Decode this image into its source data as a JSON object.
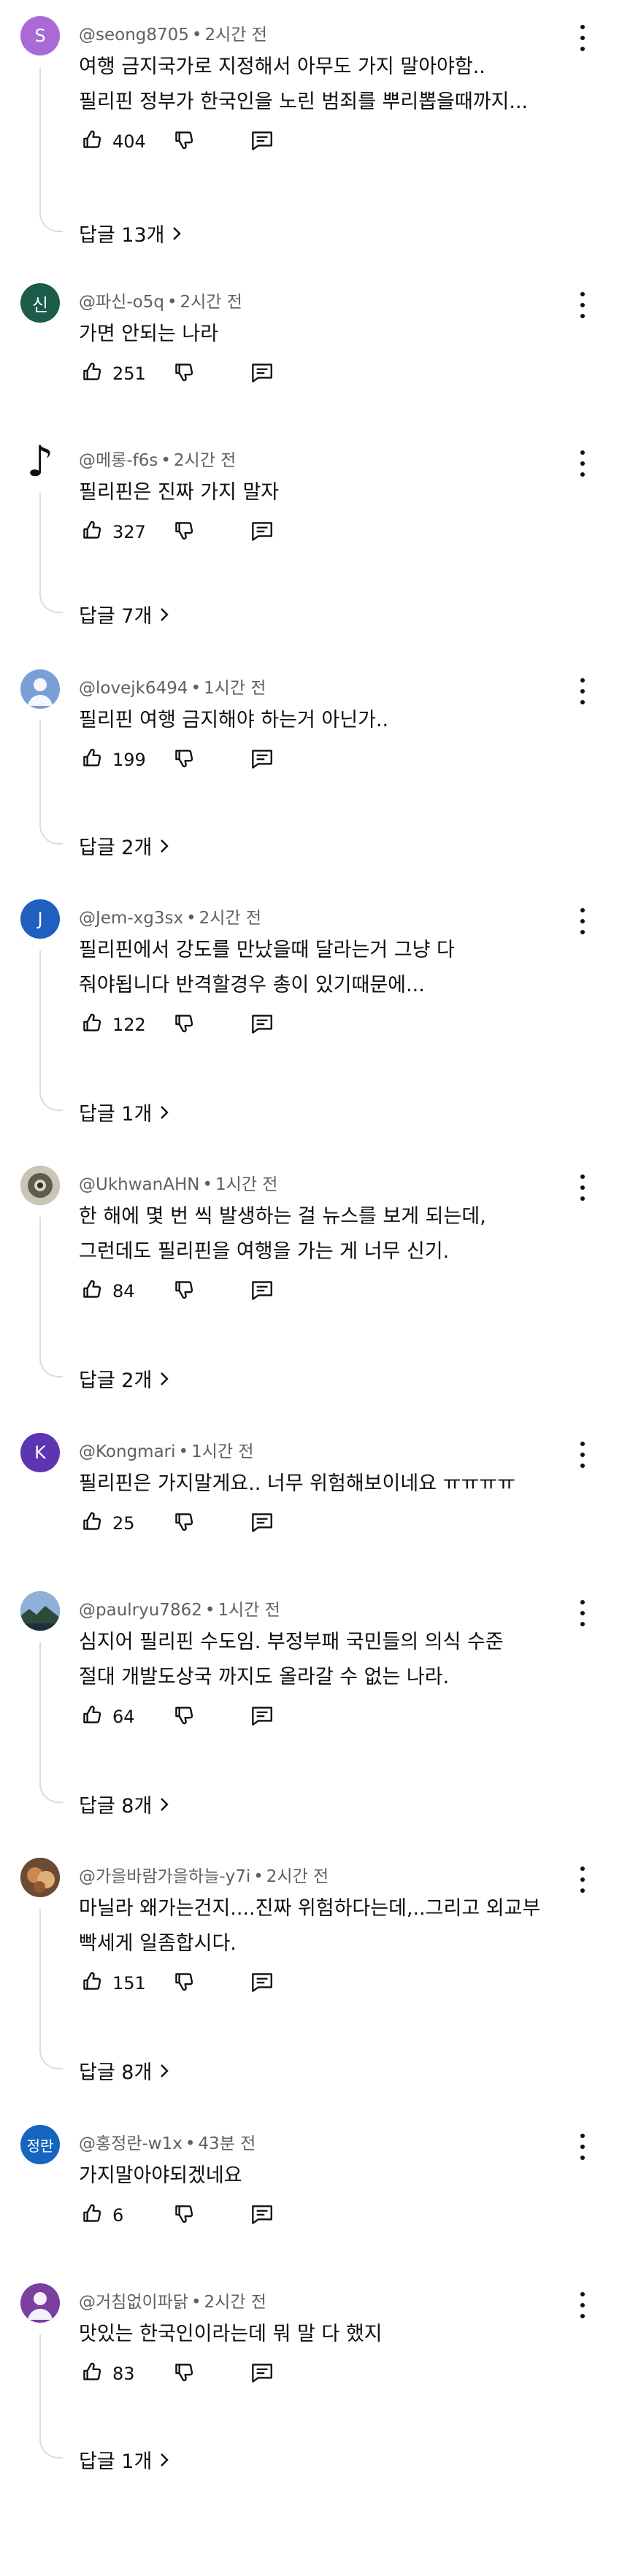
{
  "comments": [
    {
      "author": "@seong8705",
      "time": "2시간 전",
      "lines": [
        "여행 금지국가로 지정해서 아무도 가지 말아야함..",
        "필리핀 정부가 한국인을 노린 범죄를 뿌리뽑을때까지..."
      ],
      "likes": "404",
      "replies": "답글 13개",
      "avatar": {
        "letter": "S",
        "color": "#a86ad4"
      }
    },
    {
      "author": "@파신-o5q",
      "time": "2시간 전",
      "lines": [
        "가면 안되는 나라"
      ],
      "likes": "251",
      "replies": "",
      "avatar": {
        "letter": "신",
        "color": "#1b5c4b"
      }
    },
    {
      "author": "@메롱-f6s",
      "time": "2시간 전",
      "lines": [
        "필리핀은 진짜 가지 말자"
      ],
      "likes": "327",
      "replies": "답글 7개",
      "avatar": {
        "letter": "♪",
        "color": "#ffffff",
        "type": "note"
      }
    },
    {
      "author": "@lovejk6494",
      "time": "1시간 전",
      "lines": [
        "필리핀 여행 금지해야 하는거 아닌가.."
      ],
      "likes": "199",
      "replies": "답글 2개",
      "avatar": {
        "letter": "",
        "color": "#7a9ed6",
        "type": "person"
      }
    },
    {
      "author": "@Jem-xg3sx",
      "time": "2시간 전",
      "lines": [
        "필리핀에서 강도를 만났을때 달라는거 그냥 다",
        "줘야됩니다 반격할경우 총이 있기때문에..."
      ],
      "likes": "122",
      "replies": "답글 1개",
      "avatar": {
        "letter": "J",
        "color": "#1f5fbf"
      }
    },
    {
      "author": "@UkhwanAHN",
      "time": "1시간 전",
      "lines": [
        "한 해에 몇 번 씩 발생하는 걸 뉴스를 보게 되는데,",
        "그런데도 필리핀을 여행을 가는 게 너무 신기."
      ],
      "likes": "84",
      "replies": "답글 2개",
      "avatar": {
        "letter": "",
        "color": "#8a8a7a",
        "type": "photo-gear"
      }
    },
    {
      "author": "@Kongmari",
      "time": "1시간 전",
      "lines": [
        "필리핀은 가지말게요.. 너무 위험해보이네요 ㅠㅠㅠㅠ"
      ],
      "likes": "25",
      "replies": "",
      "avatar": {
        "letter": "K",
        "color": "#5e35b1"
      }
    },
    {
      "author": "@paulryu7862",
      "time": "1시간 전",
      "lines": [
        "심지어 필리핀 수도임.  부정부패 국민들의 의식 수준",
        "절대 개발도상국 까지도 올라갈 수 없는 나라."
      ],
      "likes": "64",
      "replies": "답글 8개",
      "avatar": {
        "letter": "",
        "color": "#3a4f6b",
        "type": "photo-landscape"
      }
    },
    {
      "author": "@가을바람가을하늘-y7i",
      "time": "2시간 전",
      "lines": [
        "마닐라 왜가는건지....진짜 위험하다는데,..그리고 외교부",
        "빡세게 일좀합시다."
      ],
      "likes": "151",
      "replies": "답글 8개",
      "avatar": {
        "letter": "",
        "color": "#8a5a3a",
        "type": "photo-food"
      }
    },
    {
      "author": "@홍정란-w1x",
      "time": "43분 전",
      "lines": [
        "가지말아야되겠네요"
      ],
      "likes": "6",
      "replies": "",
      "avatar": {
        "letter": "정란",
        "color": "#1565c0"
      }
    },
    {
      "author": "@거침없이파닭",
      "time": "2시간 전",
      "lines": [
        "맛있는 한국인이라는데 뭐 말 다 했지"
      ],
      "likes": "83",
      "replies": "답글 1개",
      "avatar": {
        "letter": "",
        "color": "#7b3fa0",
        "type": "person"
      }
    }
  ],
  "icons": {
    "like": "thumbs-up-icon",
    "dislike": "thumbs-down-icon",
    "reply": "comment-icon",
    "more": "more-vert-icon",
    "chevron": "chevron-right-icon"
  }
}
